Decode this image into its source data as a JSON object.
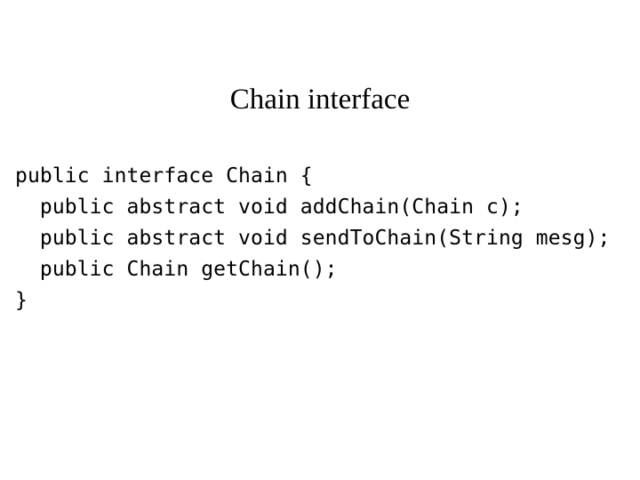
{
  "slide": {
    "background_color": "#ffffff",
    "text_color": "#000000",
    "title": "Chain interface",
    "code": {
      "language": "java",
      "lines": [
        "public interface Chain {",
        "  public abstract void addChain(Chain c);",
        "  public abstract void sendToChain(String mesg);",
        "  public Chain getChain();",
        "}"
      ]
    }
  }
}
